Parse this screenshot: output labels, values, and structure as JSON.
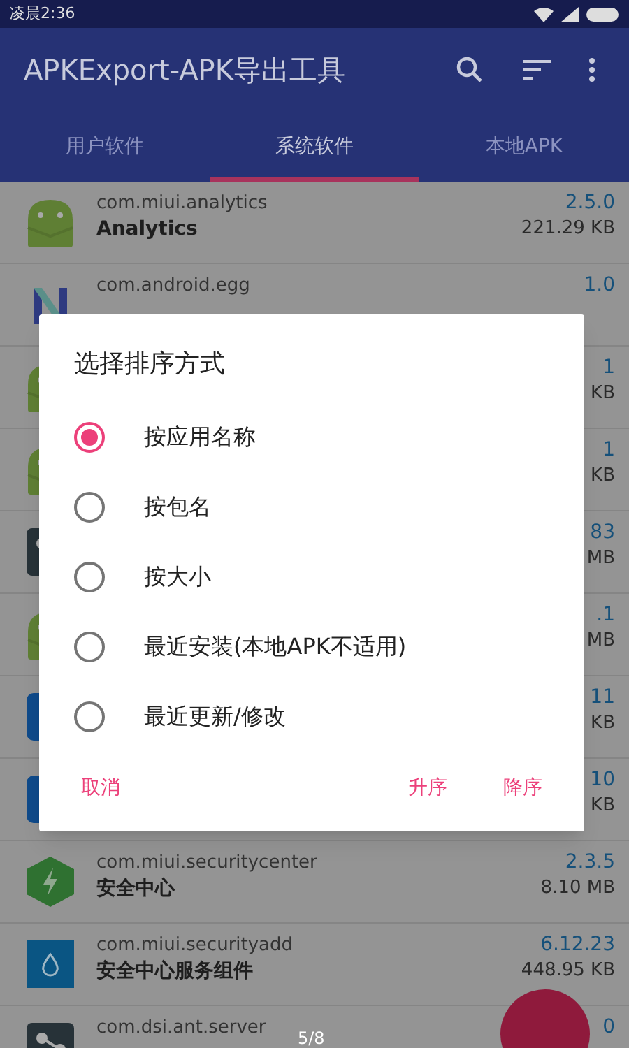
{
  "status_bar": {
    "time": "凌晨2:36"
  },
  "app_bar": {
    "title": "APKExport-APK导出工具"
  },
  "tabs": [
    {
      "label": "用户软件",
      "selected": false
    },
    {
      "label": "系统软件",
      "selected": true
    },
    {
      "label": "本地APK",
      "selected": false
    }
  ],
  "apps": [
    {
      "kind": "android",
      "package": "com.miui.analytics",
      "name": "Analytics",
      "version": "2.5.0",
      "size": "221.29 KB"
    },
    {
      "kind": "letter",
      "package": "com.android.egg",
      "version": "1.0"
    },
    {
      "kind": "android",
      "version": "1",
      "size": "KB"
    },
    {
      "kind": "android",
      "version": "1",
      "size": "KB"
    },
    {
      "kind": "dark",
      "version": "83",
      "size": "MB"
    },
    {
      "kind": "android",
      "version": ".1",
      "size": "MB"
    },
    {
      "kind": "blue",
      "version": "11",
      "size": "KB"
    },
    {
      "kind": "blue",
      "version": "10",
      "size": "KB"
    },
    {
      "kind": "hex",
      "package": "com.miui.securitycenter",
      "name": "安全中心",
      "version": "2.3.5",
      "size": "8.10 MB"
    },
    {
      "kind": "drop",
      "package": "com.miui.securityadd",
      "name": "安全中心服务组件",
      "version": "6.12.23",
      "size": "448.95 KB"
    },
    {
      "kind": "dark",
      "package": "com.dsi.ant.server",
      "version": "0"
    }
  ],
  "dialog": {
    "title": "选择排序方式",
    "options": [
      {
        "label": "按应用名称",
        "selected": true
      },
      {
        "label": "按包名",
        "selected": false
      },
      {
        "label": "按大小",
        "selected": false
      },
      {
        "label": "最近安装(本地APK不适用)",
        "selected": false
      },
      {
        "label": "最近更新/修改",
        "selected": false
      }
    ],
    "buttons": [
      "取消",
      "升序",
      "降序"
    ]
  },
  "page_indicator": "5/8"
}
